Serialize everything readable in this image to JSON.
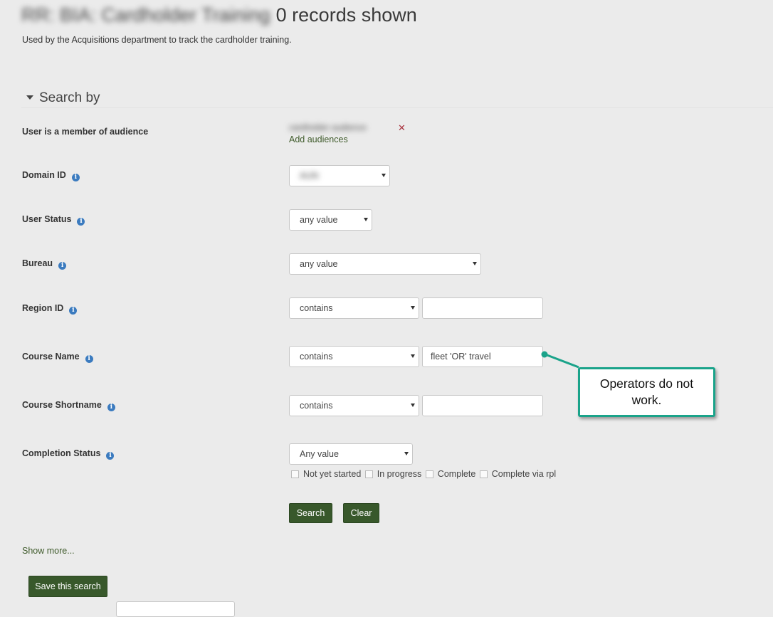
{
  "header": {
    "report_name": "RR: BIA: Cardholder Training",
    "records_shown": "0 records shown",
    "description": "Used by the Acquisitions department to track the cardholder training."
  },
  "search": {
    "heading": "Search by",
    "audience": {
      "label": "User is a member of audience",
      "chip_text": "cardholder audience",
      "add_link": "Add audiences"
    },
    "domain_id": {
      "label": "Domain ID",
      "value": "AUN"
    },
    "user_status": {
      "label": "User Status",
      "value": "any value"
    },
    "bureau": {
      "label": "Bureau",
      "value": "any value"
    },
    "region_id": {
      "label": "Region ID",
      "operator": "contains",
      "text": ""
    },
    "course_name": {
      "label": "Course Name",
      "operator": "contains",
      "text": "fleet 'OR' travel"
    },
    "course_shortname": {
      "label": "Course Shortname",
      "operator": "contains",
      "text": ""
    },
    "completion_status": {
      "label": "Completion Status",
      "value": "Any value",
      "options": [
        "Not yet started",
        "In progress",
        "Complete",
        "Complete via rpl"
      ]
    },
    "search_button": "Search",
    "clear_button": "Clear"
  },
  "show_more": "Show more...",
  "save_search_button": "Save this search",
  "callout": {
    "text": "Operators do not work.",
    "color": "#1aa38a"
  },
  "colors": {
    "button_green": "#38582b",
    "link_green": "#3e5a2a",
    "info_blue": "#3b7bbf",
    "remove_red": "#a8323e",
    "background": "#ebebeb"
  }
}
